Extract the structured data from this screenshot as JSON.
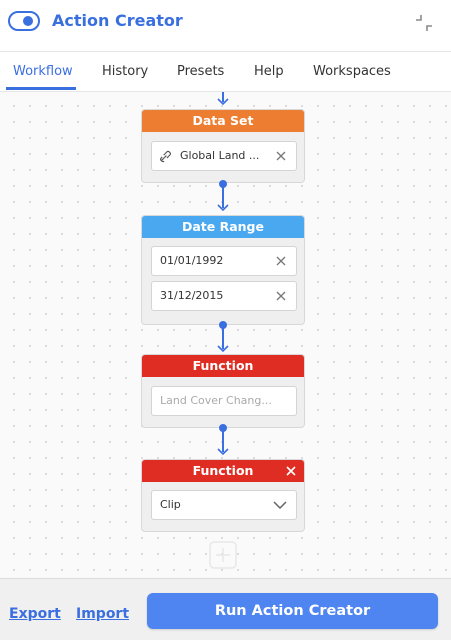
{
  "header": {
    "title": "Action Creator",
    "toggle_on": true
  },
  "tabs": [
    {
      "label": "Workflow",
      "active": true
    },
    {
      "label": "History",
      "active": false
    },
    {
      "label": "Presets",
      "active": false
    },
    {
      "label": "Help",
      "active": false
    },
    {
      "label": "Workspaces",
      "active": false
    }
  ],
  "nodes": {
    "dataset": {
      "title": "Data Set",
      "value": "Global Land ...",
      "color": "#ed7d31"
    },
    "daterange": {
      "title": "Date Range",
      "start": "01/01/1992",
      "end": "31/12/2015",
      "color": "#4aa8f0"
    },
    "function1": {
      "title": "Function",
      "placeholder": "Land Cover Chang...",
      "color": "#e02d24"
    },
    "function2": {
      "title": "Function",
      "selected": "Clip",
      "color": "#e02d24"
    }
  },
  "footer": {
    "export_label": "Export",
    "import_label": "Import",
    "run_label": "Run Action Creator"
  },
  "colors": {
    "accent": "#3a6fe0",
    "run_button": "#4f85f0"
  }
}
